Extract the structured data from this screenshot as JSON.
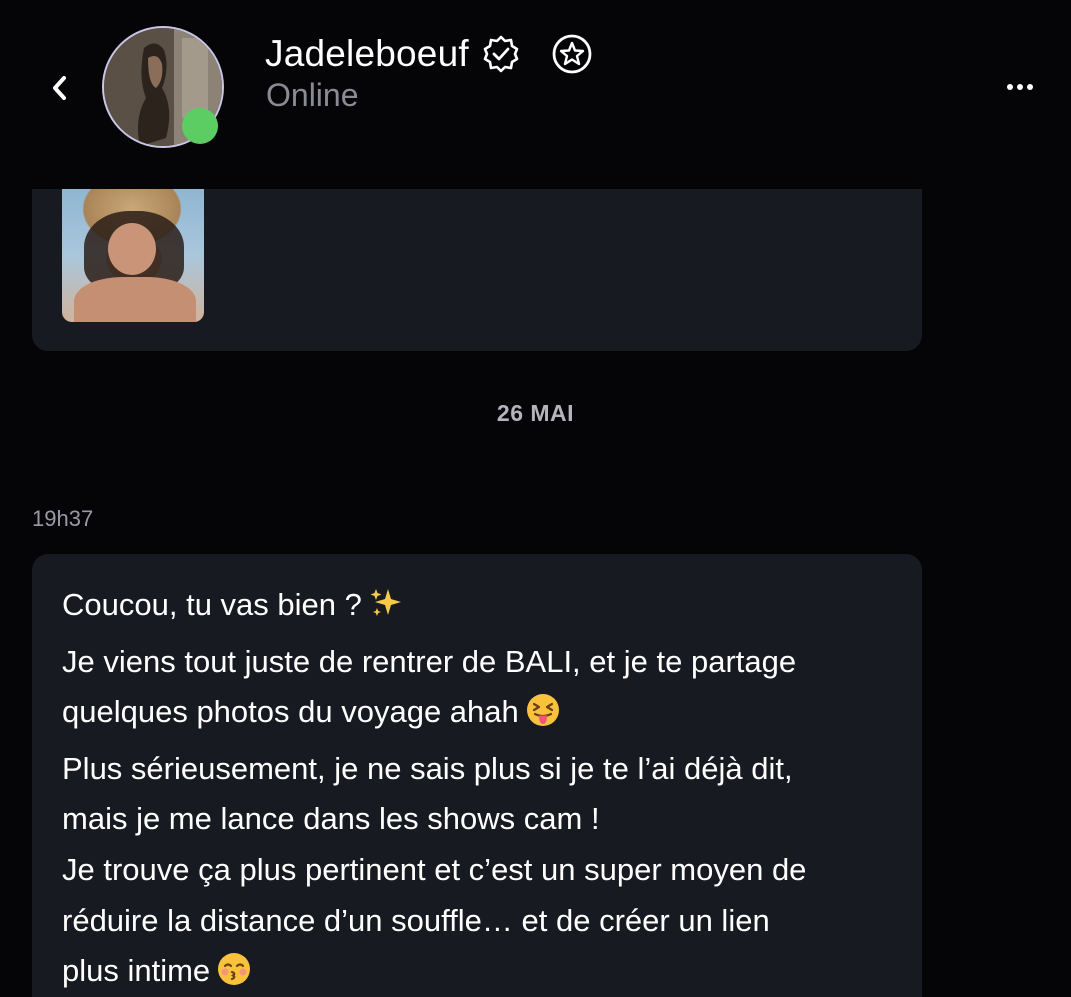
{
  "header": {
    "name": "Jadeleboeuf",
    "status": "Online",
    "icons": {
      "back": "chevron-left-icon",
      "verified": "verified-check-icon",
      "favorite": "star-circle-icon",
      "more": "more-dots-icon"
    },
    "colors": {
      "online_dot": "#5ccd63",
      "status_text": "#8b8b96"
    }
  },
  "messages": {
    "date_separator": "26 MAI",
    "time": "19h37",
    "lines": [
      "Coucou, tu vas bien ?",
      "Je viens tout juste de rentrer de BALI, et je te partage",
      "quelques photos du voyage ahah",
      "Plus sérieusement, je ne sais plus si je te l’ai déjà dit,",
      "mais je me lance dans les shows cam !",
      "Je trouve ça plus pertinent et c’est un super moyen de",
      "réduire la distance d’un souffle… et de créer un lien",
      "plus intime"
    ],
    "emojis": [
      "sparkles-emoji",
      "squinting-tongue-emoji",
      "kissing-closed-eyes-emoji"
    ]
  },
  "colors": {
    "background": "#050508",
    "bubble": "#181a21"
  }
}
